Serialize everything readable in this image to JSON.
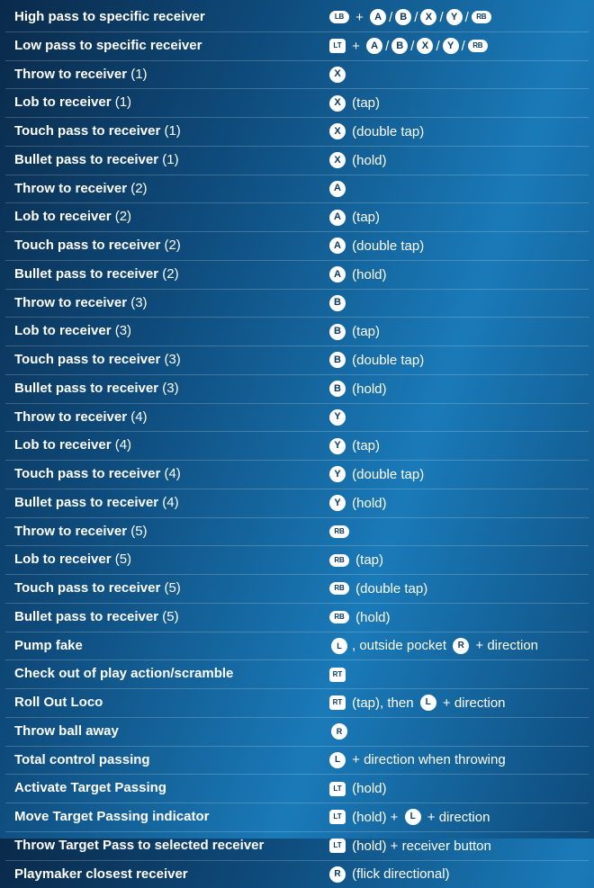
{
  "rows": [
    {
      "label": "High pass to specific receiver",
      "ctrl": [
        {
          "t": "pill",
          "v": "LB"
        },
        {
          "t": "txt",
          "v": " + "
        },
        {
          "t": "circle",
          "v": "A"
        },
        {
          "t": "txt",
          "v": "/"
        },
        {
          "t": "circle",
          "v": "B"
        },
        {
          "t": "txt",
          "v": "/"
        },
        {
          "t": "circle",
          "v": "X"
        },
        {
          "t": "txt",
          "v": "/"
        },
        {
          "t": "circle",
          "v": "Y"
        },
        {
          "t": "txt",
          "v": "/"
        },
        {
          "t": "pill",
          "v": "RB"
        }
      ]
    },
    {
      "label": "Low pass to specific receiver",
      "ctrl": [
        {
          "t": "trigger",
          "v": "LT"
        },
        {
          "t": "txt",
          "v": " + "
        },
        {
          "t": "circle",
          "v": "A"
        },
        {
          "t": "txt",
          "v": "/"
        },
        {
          "t": "circle",
          "v": "B"
        },
        {
          "t": "txt",
          "v": "/"
        },
        {
          "t": "circle",
          "v": "X"
        },
        {
          "t": "txt",
          "v": "/"
        },
        {
          "t": "circle",
          "v": "Y"
        },
        {
          "t": "txt",
          "v": "/"
        },
        {
          "t": "pill",
          "v": "RB"
        }
      ]
    },
    {
      "label": "Throw to receiver",
      "paren": "(1)",
      "ctrl": [
        {
          "t": "circle",
          "v": "X"
        }
      ]
    },
    {
      "label": "Lob to receiver",
      "paren": "(1)",
      "ctrl": [
        {
          "t": "circle",
          "v": "X"
        },
        {
          "t": "txt",
          "v": " (tap)"
        }
      ]
    },
    {
      "label": "Touch pass to receiver",
      "paren": "(1)",
      "ctrl": [
        {
          "t": "circle",
          "v": "X"
        },
        {
          "t": "txt",
          "v": " (double tap)"
        }
      ]
    },
    {
      "label": "Bullet pass to receiver",
      "paren": "(1)",
      "ctrl": [
        {
          "t": "circle",
          "v": "X"
        },
        {
          "t": "txt",
          "v": " (hold)"
        }
      ]
    },
    {
      "label": "Throw to receiver",
      "paren": "(2)",
      "ctrl": [
        {
          "t": "circle",
          "v": "A"
        }
      ]
    },
    {
      "label": "Lob to receiver",
      "paren": "(2)",
      "ctrl": [
        {
          "t": "circle",
          "v": "A"
        },
        {
          "t": "txt",
          "v": " (tap)"
        }
      ]
    },
    {
      "label": "Touch pass to receiver",
      "paren": "(2)",
      "ctrl": [
        {
          "t": "circle",
          "v": "A"
        },
        {
          "t": "txt",
          "v": " (double tap)"
        }
      ]
    },
    {
      "label": "Bullet pass to receiver",
      "paren": "(2)",
      "ctrl": [
        {
          "t": "circle",
          "v": "A"
        },
        {
          "t": "txt",
          "v": " (hold)"
        }
      ]
    },
    {
      "label": "Throw to receiver",
      "paren": "(3)",
      "ctrl": [
        {
          "t": "circle",
          "v": "B"
        }
      ]
    },
    {
      "label": "Lob to receiver",
      "paren": "(3)",
      "ctrl": [
        {
          "t": "circle",
          "v": "B"
        },
        {
          "t": "txt",
          "v": " (tap)"
        }
      ]
    },
    {
      "label": "Touch pass to receiver",
      "paren": "(3)",
      "ctrl": [
        {
          "t": "circle",
          "v": "B"
        },
        {
          "t": "txt",
          "v": " (double tap)"
        }
      ]
    },
    {
      "label": "Bullet pass to receiver",
      "paren": "(3)",
      "ctrl": [
        {
          "t": "circle",
          "v": "B"
        },
        {
          "t": "txt",
          "v": " (hold)"
        }
      ]
    },
    {
      "label": "Throw to receiver",
      "paren": "(4)",
      "ctrl": [
        {
          "t": "circle",
          "v": "Y"
        }
      ]
    },
    {
      "label": "Lob to receiver",
      "paren": "(4)",
      "ctrl": [
        {
          "t": "circle",
          "v": "Y"
        },
        {
          "t": "txt",
          "v": " (tap)"
        }
      ]
    },
    {
      "label": "Touch pass to receiver",
      "paren": "(4)",
      "ctrl": [
        {
          "t": "circle",
          "v": "Y"
        },
        {
          "t": "txt",
          "v": " (double tap)"
        }
      ]
    },
    {
      "label": "Bullet pass to receiver",
      "paren": "(4)",
      "ctrl": [
        {
          "t": "circle",
          "v": "Y"
        },
        {
          "t": "txt",
          "v": " (hold)"
        }
      ]
    },
    {
      "label": "Throw to receiver",
      "paren": "(5)",
      "ctrl": [
        {
          "t": "pill",
          "v": "RB"
        }
      ]
    },
    {
      "label": "Lob to receiver",
      "paren": "(5)",
      "ctrl": [
        {
          "t": "pill",
          "v": "RB"
        },
        {
          "t": "txt",
          "v": " (tap)"
        }
      ]
    },
    {
      "label": "Touch pass to receiver",
      "paren": "(5)",
      "ctrl": [
        {
          "t": "pill",
          "v": "RB"
        },
        {
          "t": "txt",
          "v": " (double tap)"
        }
      ]
    },
    {
      "label": "Bullet pass to receiver",
      "paren": "(5)",
      "ctrl": [
        {
          "t": "pill",
          "v": "RB"
        },
        {
          "t": "txt",
          "v": " (hold)"
        }
      ]
    },
    {
      "label": "Pump fake",
      "ctrl": [
        {
          "t": "stickLR",
          "v": "L"
        },
        {
          "t": "txt",
          "v": ", outside pocket "
        },
        {
          "t": "stickR",
          "v": "R"
        },
        {
          "t": "txt",
          "v": " + direction"
        }
      ]
    },
    {
      "label": "Check out of play action/scramble",
      "ctrl": [
        {
          "t": "trigger",
          "v": "RT"
        }
      ]
    },
    {
      "label": "Roll Out Loco",
      "ctrl": [
        {
          "t": "trigger",
          "v": "RT"
        },
        {
          "t": "txt",
          "v": " (tap), then "
        },
        {
          "t": "stickL",
          "v": "L"
        },
        {
          "t": "txt",
          "v": " + direction"
        }
      ]
    },
    {
      "label": "Throw ball away",
      "ctrl": [
        {
          "t": "stickRR",
          "v": "R"
        }
      ]
    },
    {
      "label": "Total control passing",
      "ctrl": [
        {
          "t": "stickL",
          "v": "L"
        },
        {
          "t": "txt",
          "v": " + direction when throwing"
        }
      ]
    },
    {
      "label": "Activate Target Passing",
      "ctrl": [
        {
          "t": "trigger",
          "v": "LT"
        },
        {
          "t": "txt",
          "v": " (hold)"
        }
      ]
    },
    {
      "label": "Move Target Passing indicator",
      "ctrl": [
        {
          "t": "trigger",
          "v": "LT"
        },
        {
          "t": "txt",
          "v": " (hold) + "
        },
        {
          "t": "stickL",
          "v": "L"
        },
        {
          "t": "txt",
          "v": " + direction"
        }
      ]
    },
    {
      "label": "Throw Target Pass to selected receiver",
      "ctrl": [
        {
          "t": "trigger",
          "v": "LT"
        },
        {
          "t": "txt",
          "v": " (hold) + receiver button"
        }
      ]
    },
    {
      "label": "Playmaker closest receiver",
      "ctrl": [
        {
          "t": "stickR",
          "v": "R"
        },
        {
          "t": "txt",
          "v": " (flick directional)"
        }
      ]
    }
  ]
}
